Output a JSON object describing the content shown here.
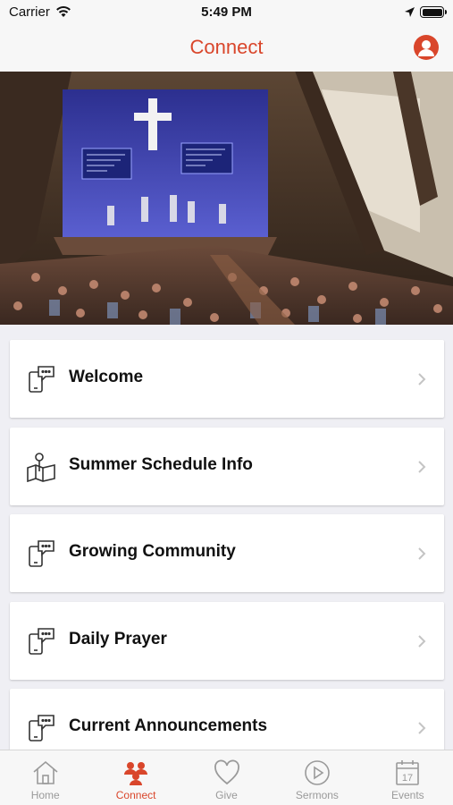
{
  "status": {
    "carrier": "Carrier",
    "time": "5:49 PM"
  },
  "header": {
    "title": "Connect"
  },
  "items": [
    {
      "label": "Welcome",
      "icon": "phone-chat-icon"
    },
    {
      "label": "Summer Schedule Info",
      "icon": "map-pin-icon"
    },
    {
      "label": "Growing Community",
      "icon": "phone-chat-icon"
    },
    {
      "label": "Daily Prayer",
      "icon": "phone-chat-icon"
    },
    {
      "label": "Current Announcements",
      "icon": "phone-chat-icon"
    }
  ],
  "tabs": [
    {
      "label": "Home",
      "icon": "home-icon",
      "active": false
    },
    {
      "label": "Connect",
      "icon": "people-icon",
      "active": true
    },
    {
      "label": "Give",
      "icon": "heart-icon",
      "active": false
    },
    {
      "label": "Sermons",
      "icon": "play-icon",
      "active": false
    },
    {
      "label": "Events",
      "icon": "calendar-icon",
      "active": false
    }
  ],
  "calendar_day": "17",
  "colors": {
    "accent": "#d9462b",
    "inactive": "#9a9a9a",
    "background": "#efeff4"
  }
}
